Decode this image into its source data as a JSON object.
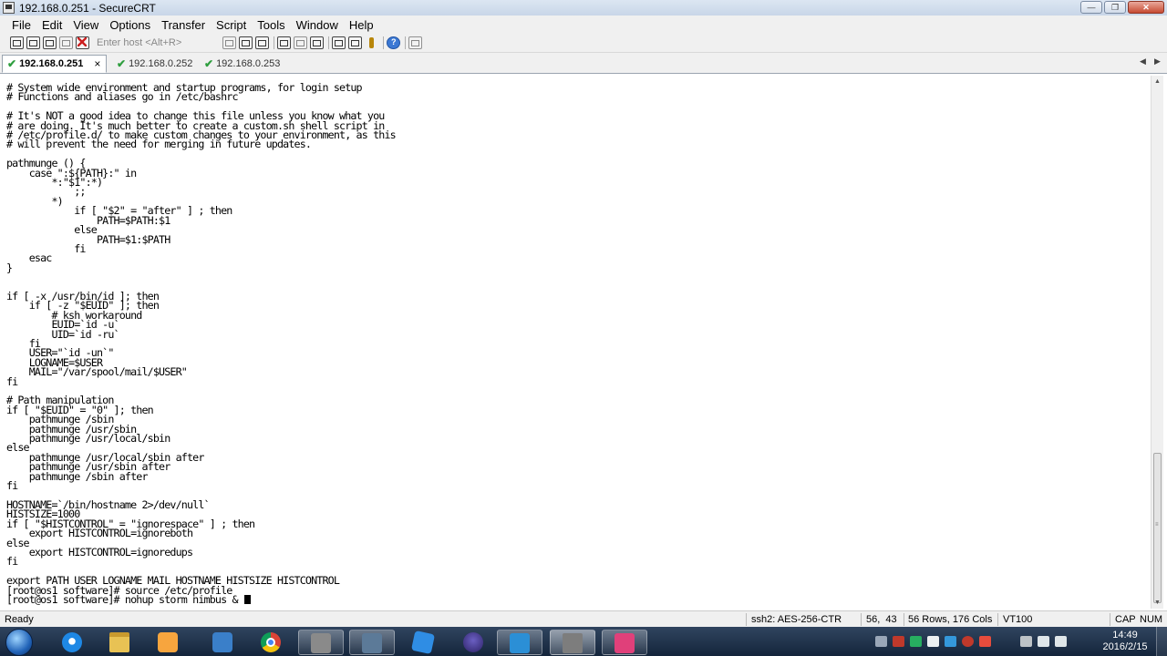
{
  "window": {
    "title": "192.168.0.251 - SecureCRT",
    "minimize": "—",
    "maximize": "❐",
    "close": "✕"
  },
  "menu": [
    "File",
    "Edit",
    "View",
    "Options",
    "Transfer",
    "Script",
    "Tools",
    "Window",
    "Help"
  ],
  "toolbar": {
    "host_placeholder": "Enter host <Alt+R>"
  },
  "tabs": [
    {
      "label": "192.168.0.251",
      "active": true,
      "close": "×"
    },
    {
      "label": "192.168.0.252",
      "active": false
    },
    {
      "label": "192.168.0.253",
      "active": false
    }
  ],
  "tab_nav": {
    "prev": "◀",
    "next": "▶"
  },
  "terminal": {
    "lines": [
      "# System wide environment and startup programs, for login setup",
      "# Functions and aliases go in /etc/bashrc",
      "",
      "# It's NOT a good idea to change this file unless you know what you",
      "# are doing. It's much better to create a custom.sh shell script in",
      "# /etc/profile.d/ to make custom changes to your environment, as this",
      "# will prevent the need for merging in future updates.",
      "",
      "pathmunge () {",
      "    case \":${PATH}:\" in",
      "        *:\"$1\":*)",
      "            ;;",
      "        *)",
      "            if [ \"$2\" = \"after\" ] ; then",
      "                PATH=$PATH:$1",
      "            else",
      "                PATH=$1:$PATH",
      "            fi",
      "    esac",
      "}",
      "",
      "",
      "if [ -x /usr/bin/id ]; then",
      "    if [ -z \"$EUID\" ]; then",
      "        # ksh workaround",
      "        EUID=`id -u`",
      "        UID=`id -ru`",
      "    fi",
      "    USER=\"`id -un`\"",
      "    LOGNAME=$USER",
      "    MAIL=\"/var/spool/mail/$USER\"",
      "fi",
      "",
      "# Path manipulation",
      "if [ \"$EUID\" = \"0\" ]; then",
      "    pathmunge /sbin",
      "    pathmunge /usr/sbin",
      "    pathmunge /usr/local/sbin",
      "else",
      "    pathmunge /usr/local/sbin after",
      "    pathmunge /usr/sbin after",
      "    pathmunge /sbin after",
      "fi",
      "",
      "HOSTNAME=`/bin/hostname 2>/dev/null`",
      "HISTSIZE=1000",
      "if [ \"$HISTCONTROL\" = \"ignorespace\" ] ; then",
      "    export HISTCONTROL=ignoreboth",
      "else",
      "    export HISTCONTROL=ignoredups",
      "fi",
      "",
      "export PATH USER LOGNAME MAIL HOSTNAME HISTSIZE HISTCONTROL",
      "[root@os1 software]# source /etc/profile",
      "[root@os1 software]# nohup storm nimbus & "
    ]
  },
  "scrollbar": {
    "up": "▲",
    "down": "▼",
    "grip": "≡"
  },
  "status": {
    "ready": "Ready",
    "cipher": "ssh2: AES-256-CTR",
    "cursor_pos": "56,  43",
    "size": "56 Rows, 176 Cols",
    "emulation": "VT100",
    "cap": "CAP",
    "num": "NUM"
  },
  "taskbar": {
    "time": "14:49",
    "date": "2016/2/15"
  }
}
